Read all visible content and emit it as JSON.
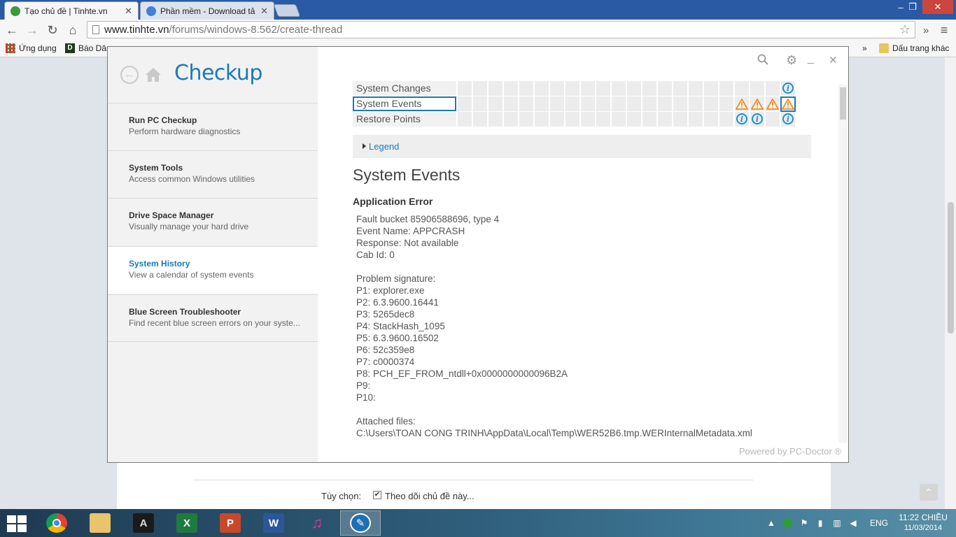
{
  "browser": {
    "tabs": [
      {
        "title": "Tạo chủ đề | Tinhte.vn",
        "active": true
      },
      {
        "title": "Phần mềm - Download tả",
        "active": false
      }
    ],
    "url_host": "www.tinhte.vn",
    "url_path": "/forums/windows-8.562/create-thread",
    "bookmarks": [
      {
        "label": "Ứng dụng",
        "icon": "apps-grid-icon"
      },
      {
        "label": "Báo Dân",
        "icon": "d-favicon"
      }
    ],
    "other_bookmarks": "Dấu trang khác",
    "overflow": "»"
  },
  "page": {
    "option_label": "Tùy chọn:",
    "option_text": "Theo dõi chủ đề này...",
    "option_checked": true
  },
  "app": {
    "title": "Checkup",
    "nav": [
      {
        "title": "Run PC Checkup",
        "desc": "Perform hardware diagnostics"
      },
      {
        "title": "System Tools",
        "desc": "Access common Windows utilities"
      },
      {
        "title": "Drive Space Manager",
        "desc": "Visually manage your hard drive"
      },
      {
        "title": "System History",
        "desc": "View a calendar of system events"
      },
      {
        "title": "Blue Screen Troubleshooter",
        "desc": "Find recent blue screen errors on your syste..."
      }
    ],
    "active_nav": 3,
    "calendar": {
      "rows": [
        "System Changes",
        "System Events",
        "Restore Points"
      ],
      "selected_row": 1
    },
    "legend": "Legend",
    "section_title": "System Events",
    "event_title": "Application Error",
    "event_lines": [
      "Fault bucket 85906588696, type 4",
      "Event Name: APPCRASH",
      "Response: Not available",
      "Cab Id: 0",
      "",
      "Problem signature:",
      "P1: explorer.exe",
      "P2: 6.3.9600.16441",
      "P3: 5265dec8",
      "P4: StackHash_1095",
      "P5: 6.3.9600.16502",
      "P6: 52c359e8",
      "P7: c0000374",
      "P8: PCH_EF_FROM_ntdll+0x0000000000096B2A",
      "P9:",
      "P10:",
      "",
      "Attached files:",
      "C:\\Users\\TOAN CONG TRINH\\AppData\\Local\\Temp\\WER52B6.tmp.WERInternalMetadata.xml"
    ],
    "powered_by": "Powered by PC-Doctor ®",
    "accent_color": "#1a7ab8",
    "warning_color": "#f08a1c",
    "info_color": "#1a8fd2"
  },
  "taskbar": {
    "apps": [
      "Google Chrome",
      "File Explorer",
      "Adobe",
      "Microsoft Excel",
      "Microsoft PowerPoint",
      "Microsoft Word",
      "Music",
      "Checkup"
    ],
    "language": "ENG",
    "time": "11:22 CHIỀU",
    "date": "11/03/2014"
  }
}
